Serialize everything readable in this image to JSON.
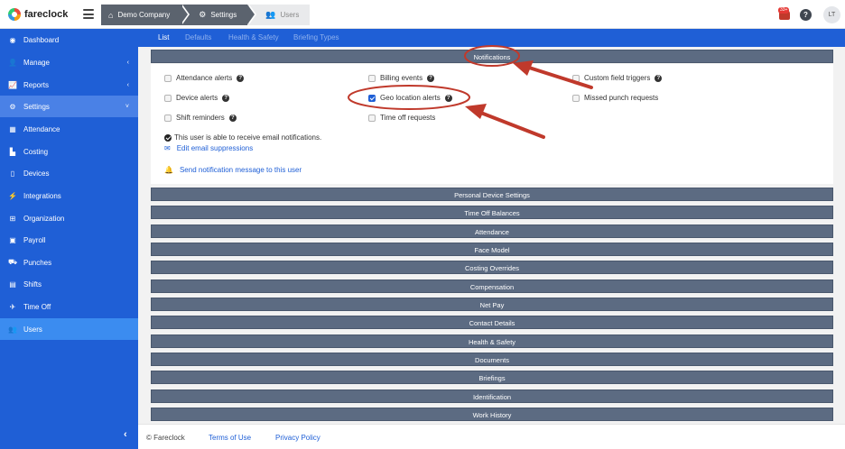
{
  "brand": {
    "name": "fareclock"
  },
  "breadcrumb": [
    {
      "label": "Demo Company",
      "icon": "home-icon"
    },
    {
      "label": "Settings",
      "icon": "gear-icon"
    },
    {
      "label": "Users",
      "icon": "users-icon"
    }
  ],
  "header": {
    "notification_count": "33+",
    "help": "?",
    "avatar_initials": "LT"
  },
  "sidebar": {
    "items": [
      {
        "label": "Dashboard",
        "icon": "dashboard-icon"
      },
      {
        "label": "Manage",
        "icon": "user-icon",
        "chevron": "‹"
      },
      {
        "label": "Reports",
        "icon": "chart-icon",
        "chevron": "‹"
      },
      {
        "label": "Settings",
        "icon": "gear-icon",
        "chevron": "˅"
      },
      {
        "label": "Attendance",
        "icon": "calendar-icon"
      },
      {
        "label": "Costing",
        "icon": "factory-icon"
      },
      {
        "label": "Devices",
        "icon": "tablet-icon"
      },
      {
        "label": "Integrations",
        "icon": "plug-icon"
      },
      {
        "label": "Organization",
        "icon": "sitemap-icon"
      },
      {
        "label": "Payroll",
        "icon": "money-icon"
      },
      {
        "label": "Punches",
        "icon": "truck-icon"
      },
      {
        "label": "Shifts",
        "icon": "clipboard-icon"
      },
      {
        "label": "Time Off",
        "icon": "plane-icon"
      },
      {
        "label": "Users",
        "icon": "users-icon"
      }
    ],
    "collapse": "‹"
  },
  "tabs": [
    "List",
    "Defaults",
    "Health & Safety",
    "Briefing Types"
  ],
  "notifications": {
    "title": "Notifications",
    "checks": [
      {
        "label": "Attendance alerts",
        "checked": false,
        "help": true
      },
      {
        "label": "Billing events",
        "checked": false,
        "help": true
      },
      {
        "label": "Custom field triggers",
        "checked": false,
        "help": true
      },
      {
        "label": "Device alerts",
        "checked": false,
        "help": true
      },
      {
        "label": "Geo location alerts",
        "checked": true,
        "help": true
      },
      {
        "label": "Missed punch requests",
        "checked": false,
        "help": false
      },
      {
        "label": "Shift reminders",
        "checked": false,
        "help": true
      },
      {
        "label": "Time off requests",
        "checked": false,
        "help": false
      }
    ],
    "email_status": "This user is able to receive email notifications.",
    "edit_suppressions": "Edit email suppressions",
    "send_message": "Send notification message to this user"
  },
  "sections": [
    "Personal Device Settings",
    "Time Off Balances",
    "Attendance",
    "Face Model",
    "Costing Overrides",
    "Compensation",
    "Net Pay",
    "Contact Details",
    "Health & Safety",
    "Documents",
    "Briefings",
    "Identification",
    "Work History"
  ],
  "footer": {
    "copyright": "© Fareclock",
    "terms": "Terms of Use",
    "privacy": "Privacy Policy"
  },
  "colors": {
    "sidebar": "#1f5fd6",
    "section_header": "#5c6b82",
    "annotation": "#c0392b"
  }
}
